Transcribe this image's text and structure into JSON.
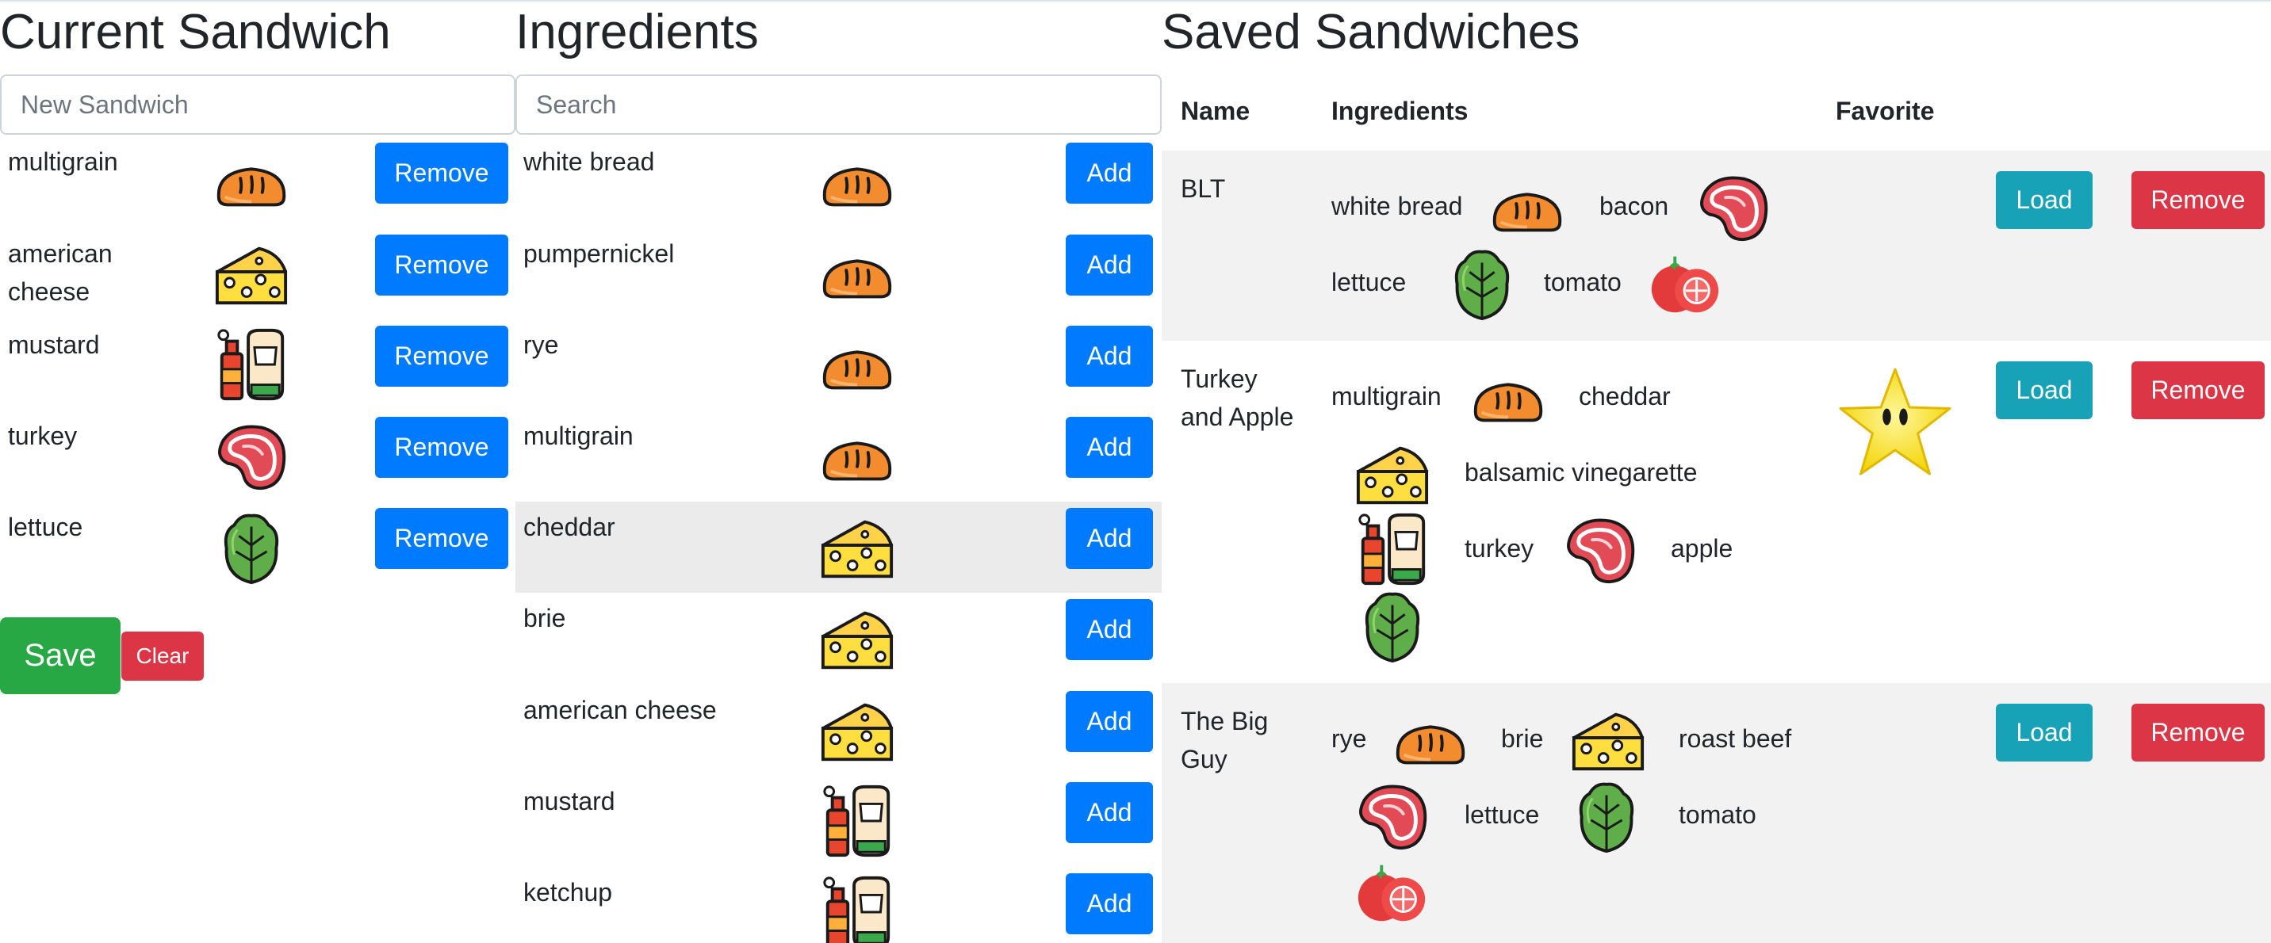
{
  "current": {
    "title": "Current Sandwich",
    "name_placeholder": "New Sandwich",
    "items": [
      {
        "label": "multigrain",
        "icon": "bread-icon",
        "button": "Remove"
      },
      {
        "label": "american cheese",
        "icon": "cheese-icon",
        "button": "Remove"
      },
      {
        "label": "mustard",
        "icon": "condiment-icon",
        "button": "Remove"
      },
      {
        "label": "turkey",
        "icon": "meat-icon",
        "button": "Remove"
      },
      {
        "label": "lettuce",
        "icon": "lettuce-icon",
        "button": "Remove"
      }
    ],
    "save_label": "Save",
    "clear_label": "Clear"
  },
  "ingredients": {
    "title": "Ingredients",
    "search_placeholder": "Search",
    "items": [
      {
        "label": "white bread",
        "icon": "bread-icon",
        "button": "Add"
      },
      {
        "label": "pumpernickel",
        "icon": "bread-icon",
        "button": "Add"
      },
      {
        "label": "rye",
        "icon": "bread-icon",
        "button": "Add"
      },
      {
        "label": "multigrain",
        "icon": "bread-icon",
        "button": "Add"
      },
      {
        "label": "cheddar",
        "icon": "cheese-icon",
        "button": "Add"
      },
      {
        "label": "brie",
        "icon": "cheese-icon",
        "button": "Add"
      },
      {
        "label": "american cheese",
        "icon": "cheese-icon",
        "button": "Add"
      },
      {
        "label": "mustard",
        "icon": "condiment-icon",
        "button": "Add"
      },
      {
        "label": "ketchup",
        "icon": "condiment-icon",
        "button": "Add"
      }
    ]
  },
  "saved": {
    "title": "Saved Sandwiches",
    "columns": {
      "name": "Name",
      "ingredients": "Ingredients",
      "favorite": "Favorite"
    },
    "load_label": "Load",
    "remove_label": "Remove",
    "rows": [
      {
        "name": "BLT",
        "favorite": false,
        "ingredients": [
          {
            "label": "white bread",
            "icon": "bread-icon"
          },
          {
            "label": "bacon",
            "icon": "meat-icon"
          },
          {
            "label": "lettuce",
            "icon": "lettuce-icon"
          },
          {
            "label": "tomato",
            "icon": "tomato-icon"
          }
        ]
      },
      {
        "name": "Turkey and Apple",
        "favorite": true,
        "ingredients": [
          {
            "label": "multigrain",
            "icon": "bread-icon"
          },
          {
            "label": "cheddar",
            "icon": "cheese-icon"
          },
          {
            "label": "balsamic vinegarette",
            "icon": "condiment-icon"
          },
          {
            "label": "turkey",
            "icon": "meat-icon"
          },
          {
            "label": "apple",
            "icon": "lettuce-icon"
          }
        ]
      },
      {
        "name": "The Big Guy",
        "favorite": false,
        "ingredients": [
          {
            "label": "rye",
            "icon": "bread-icon"
          },
          {
            "label": "brie",
            "icon": "cheese-icon"
          },
          {
            "label": "roast beef",
            "icon": "meat-icon"
          },
          {
            "label": "lettuce",
            "icon": "lettuce-icon"
          },
          {
            "label": "tomato",
            "icon": "tomato-icon"
          }
        ]
      }
    ]
  },
  "colors": {
    "primary": "#007bff",
    "info": "#17a2b8",
    "danger": "#dc3545",
    "success": "#28a745",
    "highlight": "#ebebeb",
    "stripe": "#f2f2f2"
  }
}
